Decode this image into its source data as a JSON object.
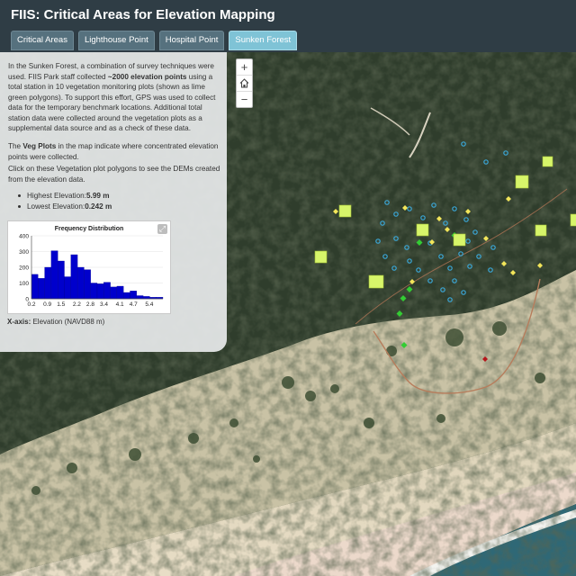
{
  "app": {
    "title": "FIIS:  Critical Areas for Elevation Mapping"
  },
  "tabs": [
    {
      "label": "Critical Areas",
      "active": false
    },
    {
      "label": "Lighthouse Point",
      "active": false
    },
    {
      "label": "Hospital Point",
      "active": false
    },
    {
      "label": "Sunken Forest",
      "active": true
    }
  ],
  "panel": {
    "intro_a": "In the Sunken Forest, a combination of survey techniques were used. FIIS Park staff collected ",
    "intro_bold": "~2000 elevation points",
    "intro_b": " using a total station in 10 vegetation monitoring plots (shown as lime green polygons). To support this effort, GPS was used to collect data for the temporary benchmark locations. Additional total station data were collected around the vegetation plots as a supplemental data source and as a check of these data.",
    "veg_a": "The ",
    "veg_bold": "Veg Plots",
    "veg_b": " in the map indicate where concentrated elevation points were collected.",
    "click_text": "Click on these Vegetation plot polygons to see the DEMs created from the elevation data.",
    "highest_label": "Highest Elevation: ",
    "highest_value": "5.99 m",
    "lowest_label": "Lowest Elevation: ",
    "lowest_value": "0.242 m",
    "xaxis_label": "X-axis:",
    "xaxis_text": " Elevation (NAVD88 m)"
  },
  "zoom": {
    "in": "+",
    "out": "−"
  },
  "icons": {
    "home": "home-icon",
    "expand": "expand-icon"
  },
  "colors": {
    "header": "#2f3d45",
    "tab": "#56717e",
    "tab_active": "#7fc3d6",
    "bar": "#0000cc",
    "veg_plot": "#d7f56a",
    "points": "#3aa7d8"
  },
  "chart_data": {
    "type": "bar",
    "title": "Frequency Distribution",
    "xlabel": "",
    "ylabel": "",
    "xticks": [
      "0.2",
      "0.9",
      "1.5",
      "2.2",
      "2.8",
      "3.4",
      "4.1",
      "4.7",
      "5.4"
    ],
    "yticks": [
      0,
      100,
      200,
      300,
      400
    ],
    "ylim": [
      0,
      400
    ],
    "xlim": [
      0.2,
      6.0
    ],
    "bin_width": 0.29,
    "values": [
      155,
      130,
      200,
      305,
      240,
      140,
      280,
      200,
      185,
      100,
      95,
      105,
      75,
      80,
      40,
      50,
      20,
      15,
      10,
      10
    ],
    "grid": true
  }
}
